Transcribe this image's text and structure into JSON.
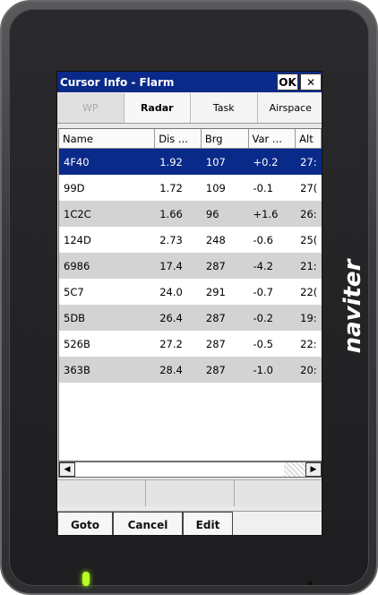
{
  "window": {
    "title": "Cursor Info -  Flarm",
    "ok_label": "OK",
    "close_label": "✕"
  },
  "tabs": [
    {
      "label": "WP",
      "state": "disabled"
    },
    {
      "label": "Radar",
      "state": "active"
    },
    {
      "label": "Task",
      "state": "normal"
    },
    {
      "label": "Airspace",
      "state": "normal"
    }
  ],
  "table": {
    "columns": [
      "Name",
      "Dis ...",
      "Brg",
      "Var ...",
      "Alt"
    ],
    "rows": [
      {
        "name": "4F40",
        "dis": "1.92",
        "brg": "107",
        "var": "+0.2",
        "alt": "27:"
      },
      {
        "name": "99D",
        "dis": "1.72",
        "brg": "109",
        "var": "-0.1",
        "alt": "27("
      },
      {
        "name": "1C2C",
        "dis": "1.66",
        "brg": "96",
        "var": "+1.6",
        "alt": "26:"
      },
      {
        "name": "124D",
        "dis": "2.73",
        "brg": "248",
        "var": "-0.6",
        "alt": "25("
      },
      {
        "name": "6986",
        "dis": "17.4",
        "brg": "287",
        "var": "-4.2",
        "alt": "21:"
      },
      {
        "name": "5C7",
        "dis": "24.0",
        "brg": "291",
        "var": "-0.7",
        "alt": "22("
      },
      {
        "name": "5DB",
        "dis": "26.4",
        "brg": "287",
        "var": "-0.2",
        "alt": "19:"
      },
      {
        "name": "526B",
        "dis": "27.2",
        "brg": "287",
        "var": "-0.5",
        "alt": "22:"
      },
      {
        "name": "363B",
        "dis": "28.4",
        "brg": "287",
        "var": "-1.0",
        "alt": "20:"
      }
    ],
    "selected_index": 0
  },
  "scrollbar": {
    "left_arrow": "◀",
    "right_arrow": "▶"
  },
  "bottom": {
    "goto": "Goto",
    "cancel": "Cancel",
    "edit": "Edit"
  },
  "device": {
    "brand": "naviter"
  },
  "colors": {
    "titlebar": "#0a2a8a",
    "selection": "#0a2a8a",
    "alt_row": "#d3d3d3",
    "led": "#b8ff2a"
  }
}
